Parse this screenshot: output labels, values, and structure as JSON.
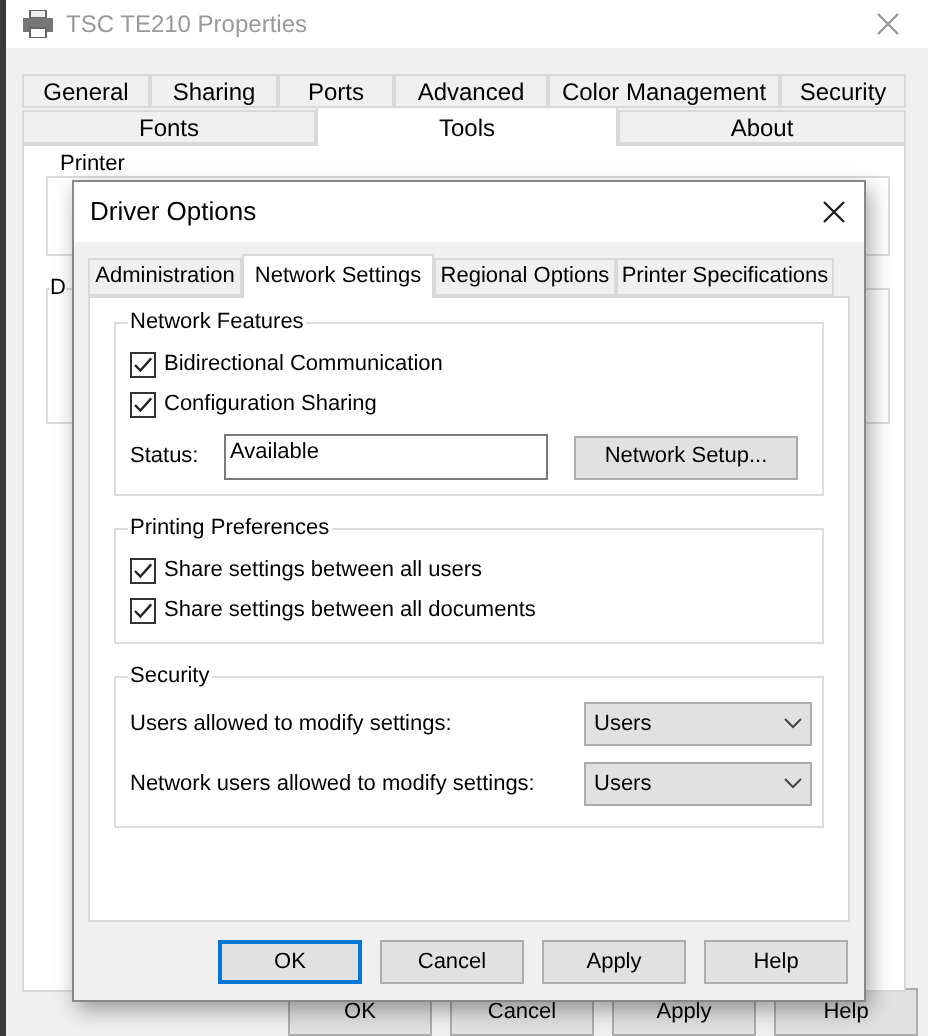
{
  "window": {
    "title": "TSC TE210 Properties"
  },
  "tab_rows": [
    [
      {
        "label": "General",
        "selected": false
      },
      {
        "label": "Sharing",
        "selected": false
      },
      {
        "label": "Ports",
        "selected": false
      },
      {
        "label": "Advanced",
        "selected": false
      },
      {
        "label": "Color Management",
        "selected": false
      },
      {
        "label": "Security",
        "selected": false
      }
    ],
    [
      {
        "label": "Fonts",
        "selected": false
      },
      {
        "label": "Tools",
        "selected": true
      },
      {
        "label": "About",
        "selected": false
      }
    ]
  ],
  "groups": [
    {
      "label": "Printer"
    },
    {
      "label": "D"
    }
  ],
  "buttons": [
    {
      "label": "OK"
    },
    {
      "label": "Cancel"
    },
    {
      "label": "Apply"
    },
    {
      "label": "Help"
    }
  ],
  "dialog": {
    "title": "Driver Options",
    "tabs": [
      {
        "label": "Administration",
        "selected": false
      },
      {
        "label": "Network Settings",
        "selected": true
      },
      {
        "label": "Regional Options",
        "selected": false
      },
      {
        "label": "Printer Specifications",
        "selected": false
      }
    ],
    "network_features": {
      "label": "Network Features",
      "checkboxes": [
        {
          "label": "Bidirectional Communication",
          "checked": true
        },
        {
          "label": "Configuration Sharing",
          "checked": true
        }
      ],
      "status": {
        "label": "Status:",
        "value": "Available"
      },
      "button": "Network Setup..."
    },
    "printing_preferences": {
      "label": "Printing Preferences",
      "checkboxes": [
        {
          "label": "Share settings between all users",
          "checked": true
        },
        {
          "label": "Share settings between all documents",
          "checked": true
        }
      ]
    },
    "security": {
      "label": "Security",
      "fields": [
        {
          "label": "Users allowed to modify settings:",
          "value": "Users"
        },
        {
          "label": "Network users allowed to modify settings:",
          "value": "Users"
        }
      ]
    },
    "buttons": [
      {
        "label": "OK",
        "default": true
      },
      {
        "label": "Cancel",
        "default": false
      },
      {
        "label": "Apply",
        "default": false
      },
      {
        "label": "Help",
        "default": false
      }
    ]
  }
}
